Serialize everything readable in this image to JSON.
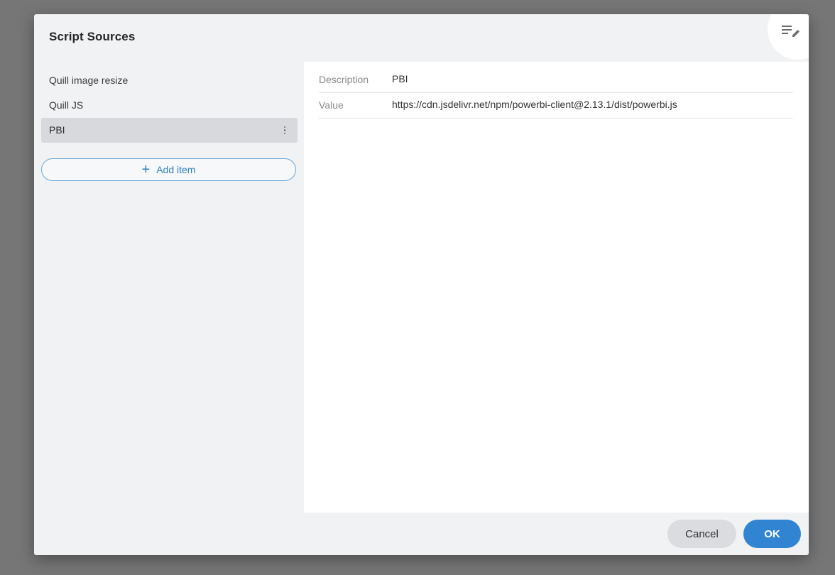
{
  "dialog": {
    "title": "Script Sources",
    "edit_icon": "edit-list-icon"
  },
  "list": {
    "items": [
      {
        "label": "Quill image resize",
        "selected": false
      },
      {
        "label": "Quill JS",
        "selected": false
      },
      {
        "label": "PBI",
        "selected": true,
        "menu_icon": "kebab-menu-icon"
      }
    ],
    "add_item_label": "Add item",
    "add_item_icon": "plus-icon"
  },
  "detail": {
    "description_label": "Description",
    "description_value": "PBI",
    "value_label": "Value",
    "value_value": "https://cdn.jsdelivr.net/npm/powerbi-client@2.13.1/dist/powerbi.js"
  },
  "footer": {
    "cancel_label": "Cancel",
    "ok_label": "OK"
  },
  "colors": {
    "accent": "#3184d1",
    "selected_row": "#d7d9dd",
    "dialog_bg": "#f1f2f4",
    "overlay": "#767676"
  }
}
